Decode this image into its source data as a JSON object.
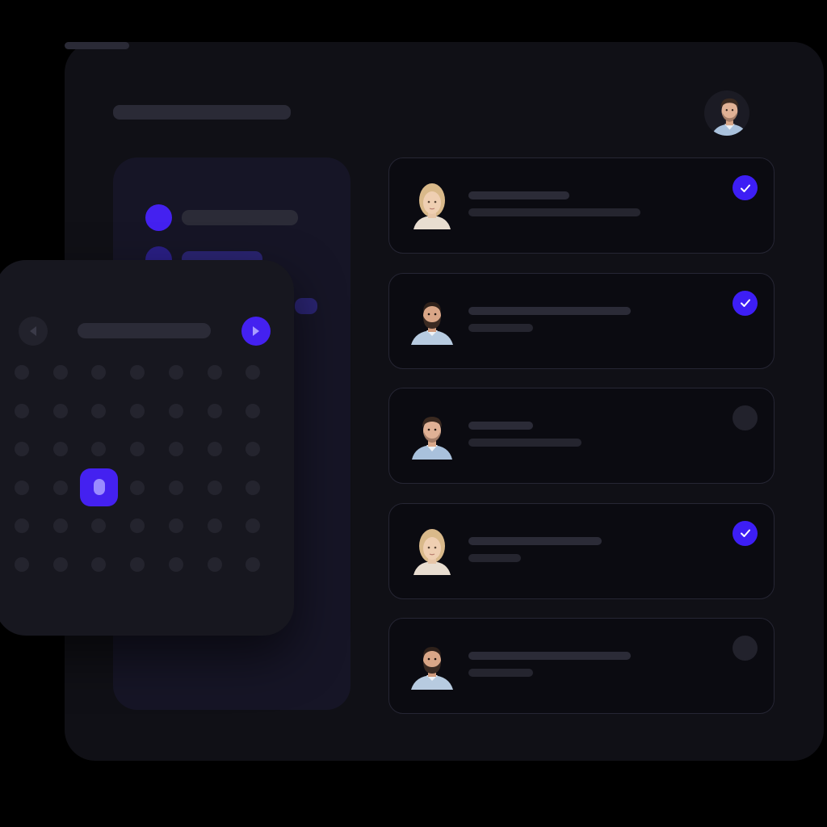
{
  "colors": {
    "accent": "#3d1ef5",
    "panel": "#101016",
    "card": "#0b0b11",
    "sidebar": "#161526",
    "calendar": "#17171f"
  },
  "header": {
    "avatar_icon": "avatar-man-icon"
  },
  "sidebar": {
    "items": [
      {
        "icon": "nav-dot-icon",
        "active": true
      },
      {
        "icon": "nav-dot-icon",
        "active": false
      }
    ]
  },
  "calendar": {
    "prev_icon": "chevron-left-icon",
    "next_icon": "chevron-right-icon",
    "rows": 6,
    "cols": 7,
    "selected_day": {
      "row": 3,
      "col": 2
    }
  },
  "contacts": [
    {
      "avatar": "avatar-woman-icon",
      "checked": true
    },
    {
      "avatar": "avatar-man-beard-icon",
      "checked": true
    },
    {
      "avatar": "avatar-man-icon",
      "checked": false
    },
    {
      "avatar": "avatar-woman-icon",
      "checked": true
    },
    {
      "avatar": "avatar-man-beard-icon",
      "checked": false
    }
  ]
}
